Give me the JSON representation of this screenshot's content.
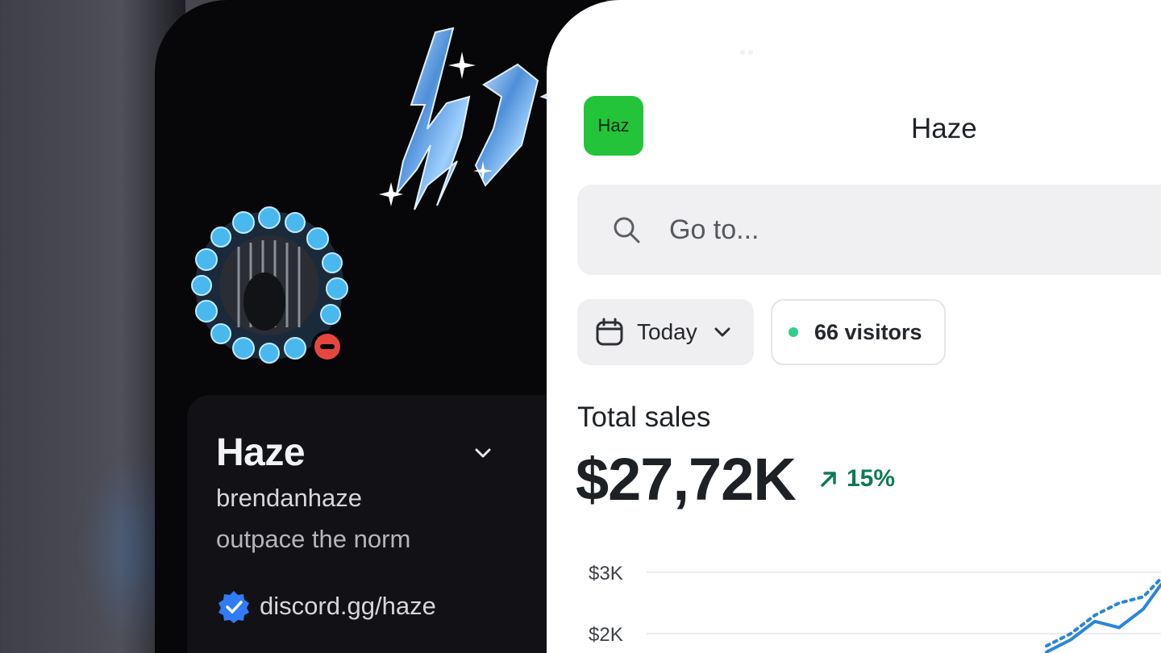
{
  "discord_profile": {
    "display_name": "Haze",
    "username": "brendanhaze",
    "about": "outpace the norm",
    "link": "discord.gg/haze",
    "status": "do-not-disturb"
  },
  "analytics": {
    "store_badge": "Haz",
    "store_title": "Haze",
    "search": {
      "placeholder": "Go to..."
    },
    "date_filter": "Today",
    "visitors_label": "66 visitors",
    "metric": {
      "label": "Total sales",
      "value": "$27,72K",
      "trend": "15%"
    },
    "colors": {
      "badge": "#23c33a",
      "live_dot": "#2fcf8b",
      "trend": "#0e7a55",
      "chart_line": "#2a86d9"
    }
  },
  "chart_data": {
    "type": "line",
    "y_ticks": [
      "$3K",
      "$2K"
    ],
    "series": [
      {
        "values": [
          1.7,
          1.9,
          2.2,
          2.1,
          2.4,
          2.8
        ]
      },
      {
        "values": [
          1.8,
          2.0,
          2.3,
          2.5,
          2.6,
          2.9
        ]
      }
    ]
  }
}
